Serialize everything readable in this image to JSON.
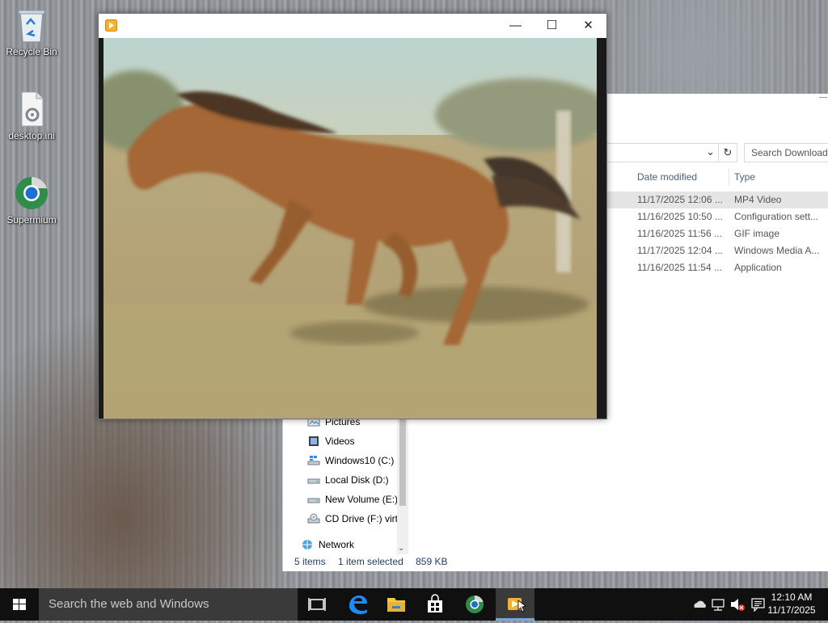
{
  "desktop": {
    "icons": [
      {
        "label": "Recycle Bin",
        "icon": "recycle-bin-icon"
      },
      {
        "label": "desktop.ini",
        "icon": "settings-file-icon"
      },
      {
        "label": "Supermium",
        "icon": "supermium-browser-icon"
      }
    ]
  },
  "player_window": {
    "title": "",
    "controls": {
      "minimize": "—",
      "maximize": "☐",
      "close": "✕"
    }
  },
  "explorer": {
    "search_placeholder": "Search Downloads",
    "columns": {
      "date": "Date modified",
      "type": "Type"
    },
    "files": [
      {
        "date": "11/17/2025 12:06 ...",
        "type": "MP4 Video",
        "selected": true
      },
      {
        "date": "11/16/2025 10:50 ...",
        "type": "Configuration sett...",
        "selected": false
      },
      {
        "date": "11/16/2025 11:56 ...",
        "type": "GIF image",
        "selected": false
      },
      {
        "date": "11/17/2025 12:04 ...",
        "type": "Windows Media A...",
        "selected": false
      },
      {
        "date": "11/16/2025 11:54 ...",
        "type": "Application",
        "selected": false
      }
    ],
    "nav": [
      {
        "label": "Pictures",
        "icon": "pictures-folder-icon"
      },
      {
        "label": "Videos",
        "icon": "videos-folder-icon"
      },
      {
        "label": "Windows10 (C:)",
        "icon": "windows-drive-icon"
      },
      {
        "label": "Local Disk (D:)",
        "icon": "drive-icon"
      },
      {
        "label": "New Volume (E:)",
        "icon": "drive-icon"
      },
      {
        "label": "CD Drive (F:) virt",
        "icon": "cd-drive-icon"
      },
      {
        "label": "Network",
        "icon": "network-icon"
      }
    ],
    "status": {
      "items": "5 items",
      "selected": "1 item selected",
      "size": "859 KB"
    }
  },
  "taskbar": {
    "search_placeholder": "Search the web and Windows",
    "pinned": [
      "task-view-icon",
      "edge-icon",
      "file-explorer-icon",
      "store-icon",
      "supermium-icon",
      "media-player-icon"
    ],
    "tray_icons": [
      "onedrive-icon",
      "network-icon",
      "volume-muted-icon",
      "action-center-icon"
    ],
    "clock": {
      "time": "12:10 AM",
      "date": "11/17/2025"
    }
  },
  "colors": {
    "accent": "#0078d7",
    "taskbar": "#101010",
    "search_box": "#3a3a3a"
  }
}
